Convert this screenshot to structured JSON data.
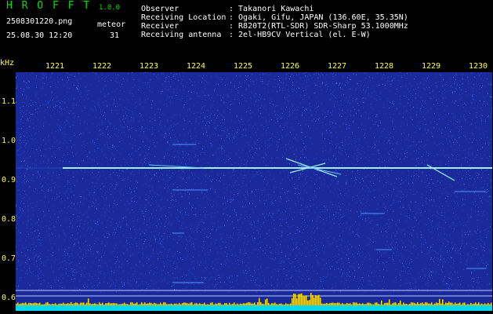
{
  "header": {
    "app_title": "H R O F F T",
    "version": "1.0.0",
    "filename": "2508301220.png",
    "timestamp": "25.08.30 12:20",
    "meteor_label": "meteor",
    "meteor_count": "31",
    "info_rows": [
      {
        "label": "Observer",
        "value": ": Takanori Kawachi"
      },
      {
        "label": "Receiving Location",
        "value": ": Ogaki, Gifu, JAPAN (136.60E, 35.35N)"
      },
      {
        "label": "Receiver",
        "value": ": R820T2(RTL-SDR) SDR-Sharp 53.1000MHz"
      },
      {
        "label": "Receiving antenna",
        "value": ": 2el-HB9CV Vertical (el. E-W)"
      }
    ]
  },
  "y_axis": {
    "unit": "kHz",
    "ticks": [
      "1.1",
      "1.0",
      "0.9",
      "0.8",
      "0.7",
      "0.6"
    ]
  },
  "x_axis": {
    "ticks": [
      "1221",
      "1222",
      "1223",
      "1224",
      "1225",
      "1226",
      "1227",
      "1228",
      "1229",
      "1230"
    ]
  },
  "colors": {
    "background": "#1a2a9a",
    "noise": "#3050d0",
    "signal": "#a0f0ff",
    "baseline": "#00d8f0",
    "burst": "#ffe000",
    "label": "#ffff40",
    "header_green": "#00e000"
  }
}
